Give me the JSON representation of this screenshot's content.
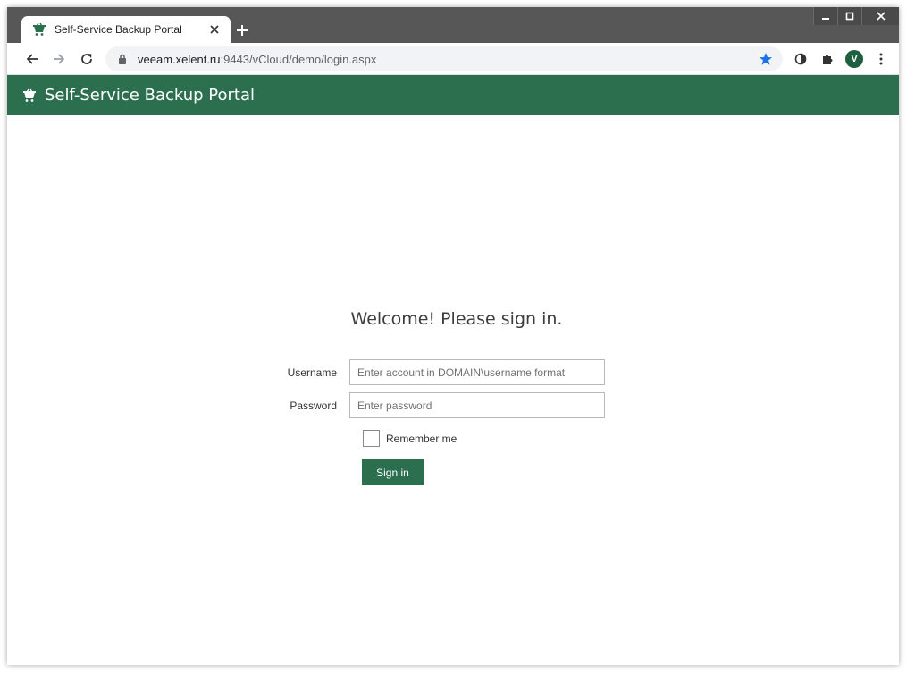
{
  "browser": {
    "tab_title": "Self-Service Backup Portal",
    "url_host": "veeam.xelent.ru",
    "url_rest": ":9443/vCloud/demo/login.aspx",
    "profile_initial": "V",
    "icons": {
      "favicon": "basket-icon",
      "tab_close": "close-icon",
      "new_tab": "plus-icon",
      "back": "back-arrow-icon",
      "forward": "forward-arrow-icon",
      "reload": "reload-icon",
      "lock": "lock-icon",
      "bookmark": "star-icon",
      "extension1": "circle-extension-icon",
      "extensions": "puzzle-icon",
      "menu": "kebab-menu-icon"
    }
  },
  "header": {
    "title": "Self-Service Backup Portal",
    "color": "#2b6f4f"
  },
  "login": {
    "heading": "Welcome! Please sign in.",
    "username_label": "Username",
    "username_placeholder": "Enter account in DOMAIN\\username format",
    "username_value": "",
    "password_label": "Password",
    "password_placeholder": "Enter password",
    "password_value": "",
    "remember_label": "Remember me",
    "remember_checked": false,
    "signin_label": "Sign in"
  }
}
